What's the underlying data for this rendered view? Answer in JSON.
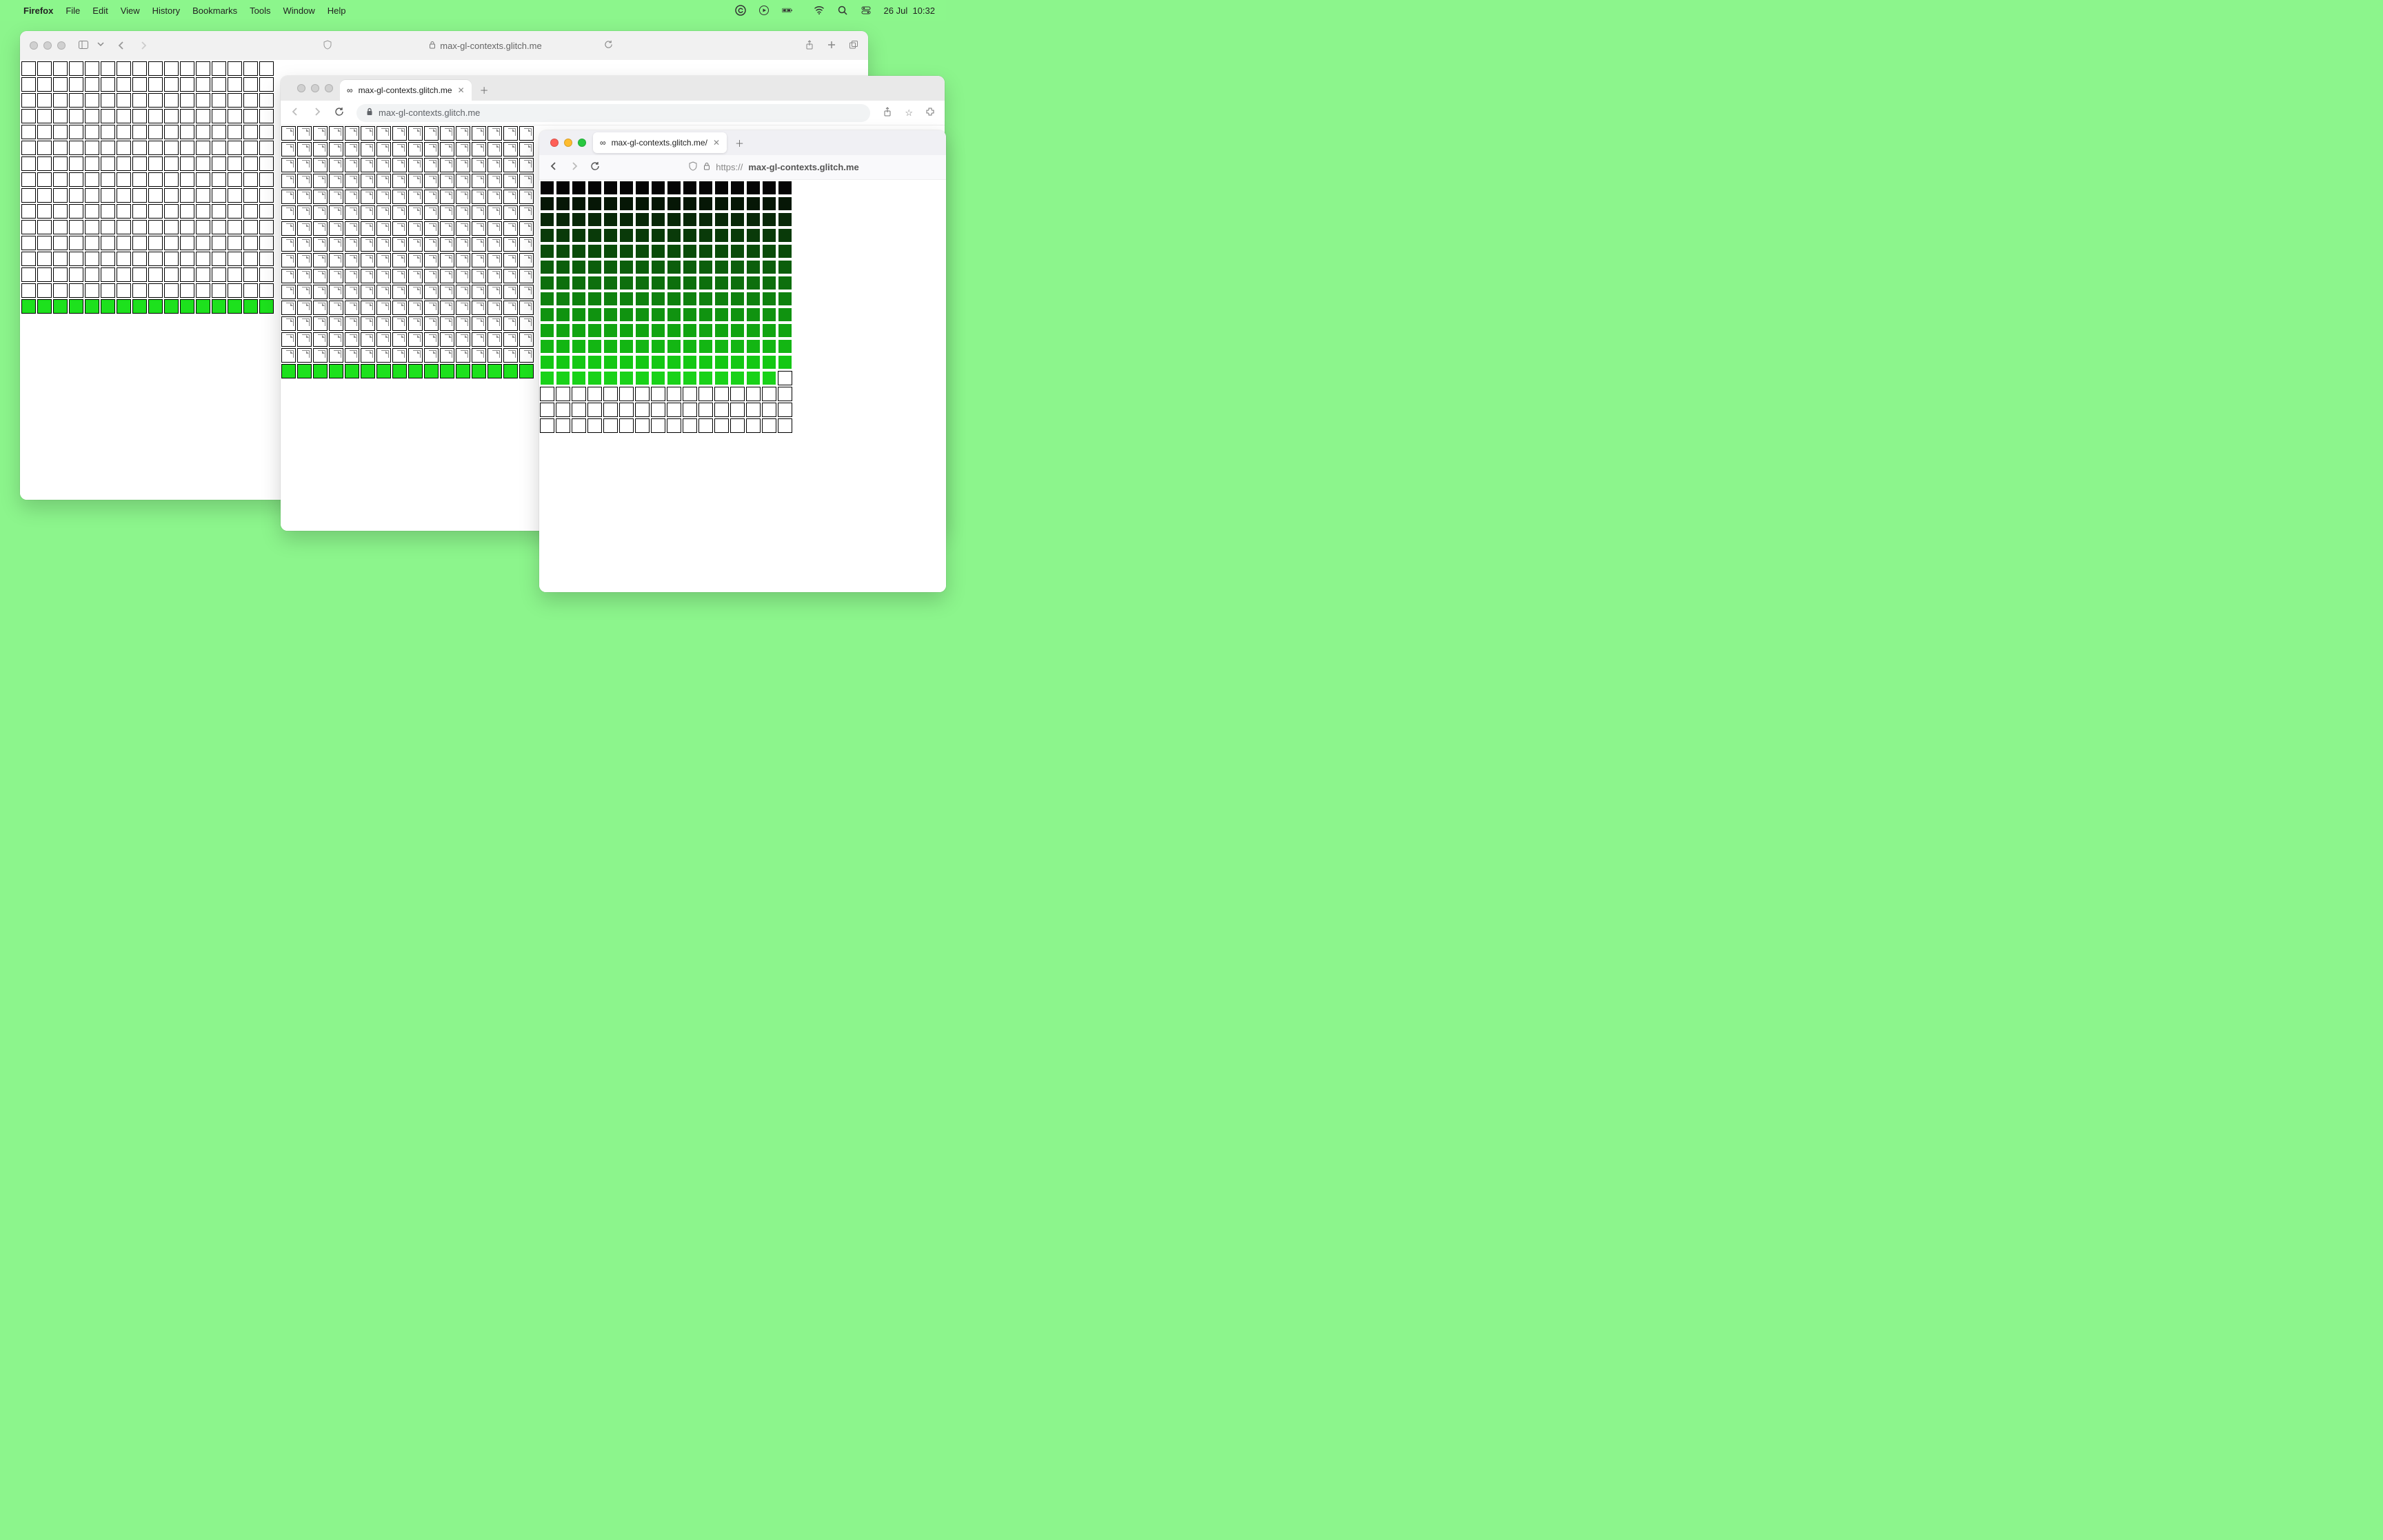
{
  "menubar": {
    "app": "Firefox",
    "items": [
      "File",
      "Edit",
      "View",
      "History",
      "Bookmarks",
      "Tools",
      "Window",
      "Help"
    ],
    "date": "26 Jul",
    "time": "10:32"
  },
  "safari": {
    "url_display": "max-gl-contexts.glitch.me",
    "grid": {
      "cols": 16,
      "rows_empty": 15,
      "rows_green": 1
    }
  },
  "chrome": {
    "tab_title": "max-gl-contexts.glitch.me",
    "url_display": "max-gl-contexts.glitch.me",
    "grid": {
      "cols": 16,
      "rows_broken": 15,
      "rows_green": 1
    }
  },
  "firefox": {
    "tab_title": "max-gl-contexts.glitch.me/",
    "url_proto": "https://",
    "url_host": "max-gl-contexts.glitch.me",
    "grid": {
      "cols": 16,
      "gradient_rows": 12,
      "last_row_short": 15,
      "empty_rows": 3
    }
  }
}
